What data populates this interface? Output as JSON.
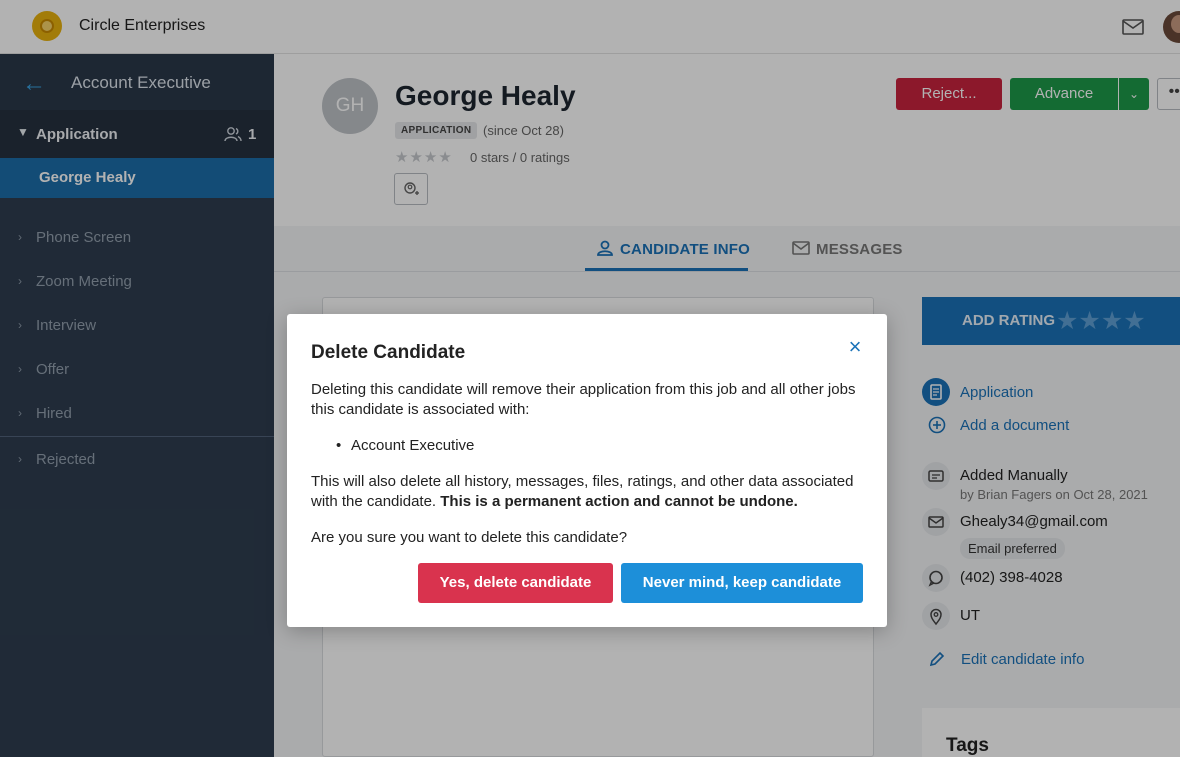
{
  "topbar": {
    "company": "Circle Enterprises",
    "logo_icon": "circle-logo-icon",
    "mail_icon": "mail-icon",
    "avatar_icon": "user-avatar"
  },
  "sidebar": {
    "job_title": "Account Executive",
    "back_icon": "back-arrow-icon",
    "current_stage": {
      "label": "Application",
      "count": "1"
    },
    "active_candidate": "George Healy",
    "stages": [
      "Phone Screen",
      "Zoom Meeting",
      "Interview",
      "Offer",
      "Hired"
    ],
    "rejected": "Rejected"
  },
  "candidate": {
    "initials": "GH",
    "name": "George Healy",
    "stage_badge": "APPLICATION",
    "since": "(since Oct 28)",
    "stars": "★★★★",
    "rating_text": "0 stars / 0 ratings",
    "rating_value": 0
  },
  "actions": {
    "reject": "Reject...",
    "advance": "Advance",
    "advance_dropdown": "⌄",
    "more": "•••"
  },
  "tabs": {
    "info": "CANDIDATE INFO",
    "messages": "MESSAGES"
  },
  "side": {
    "add_rating": "ADD RATING",
    "rating_stars": "★★★★",
    "application_link": "Application",
    "add_document": "Add a document",
    "added_manually": "Added Manually",
    "added_by": "by Brian Fagers on Oct 28, 2021",
    "email": "Ghealy34@gmail.com",
    "email_pref": "Email preferred",
    "phone": "(402) 398-4028",
    "location": "UT",
    "edit_info": "Edit candidate info",
    "tags_title": "Tags"
  },
  "modal": {
    "title": "Delete Candidate",
    "close": "×",
    "paragraph1": "Deleting this candidate will remove their application from this job and all other jobs this candidate is associated with:",
    "job_item": "Account Executive",
    "paragraph2_start": "This will also delete all history, messages, files, ratings, and other data associated with the candidate. ",
    "paragraph2_bold": "This is a permanent action and cannot be undone.",
    "question": "Are you sure you want to delete this candidate?",
    "confirm_button": "Yes, delete candidate",
    "cancel_button": "Never mind, keep candidate"
  },
  "colors": {
    "sidebar_bg": "#2e3d4f",
    "accent_blue": "#1a72b8",
    "reject_red": "#c9233e",
    "advance_green": "#1e9a4a",
    "delete_red": "#d9334e",
    "keep_blue": "#1d8fd9"
  }
}
